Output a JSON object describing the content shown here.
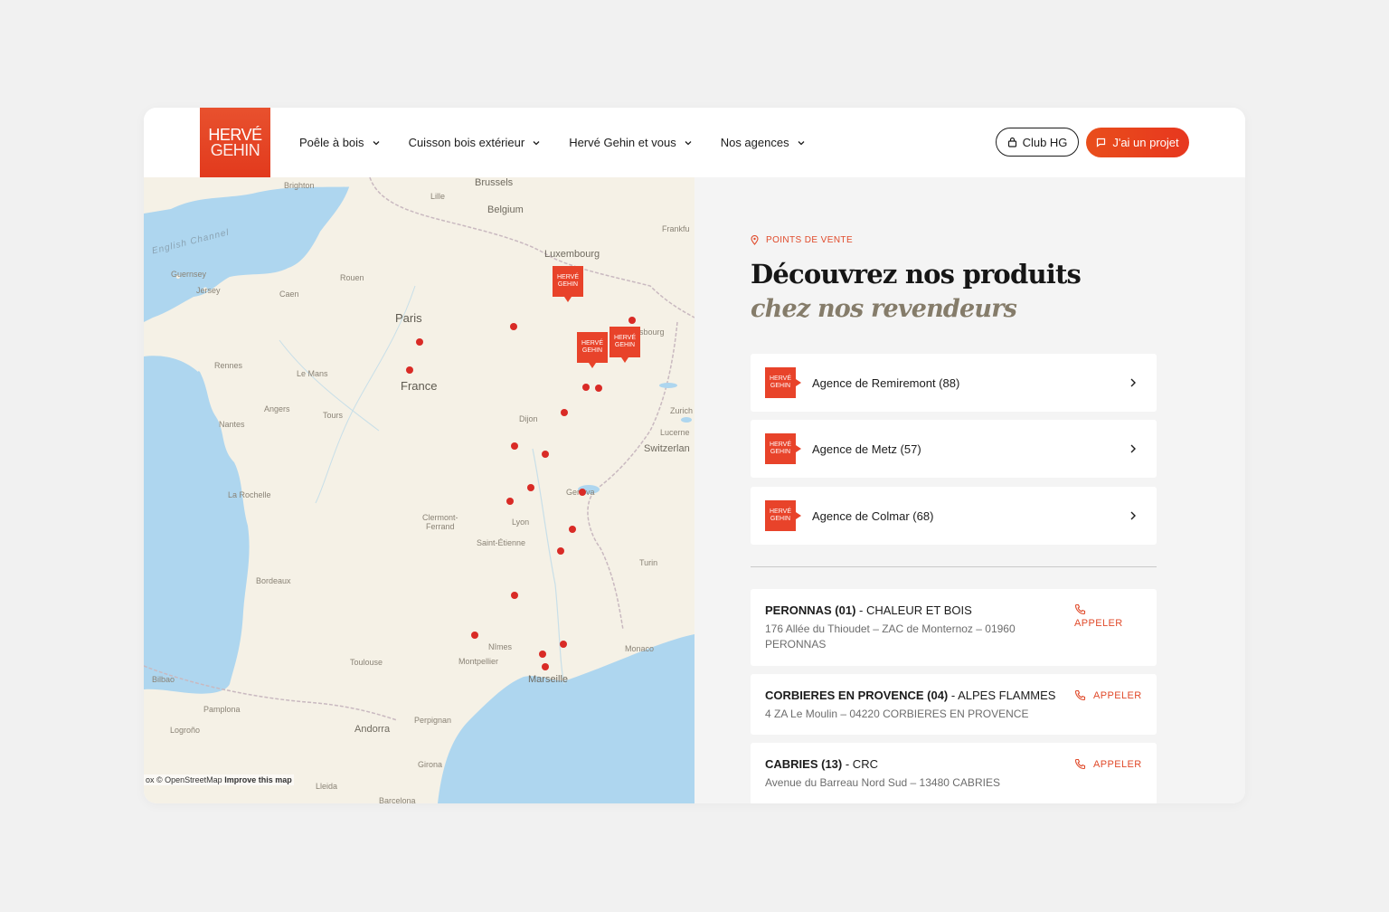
{
  "brand": {
    "line1": "HERVÉ",
    "line2": "GEHIN",
    "accent": "#e8432a"
  },
  "nav": [
    {
      "label": "Poêle à bois"
    },
    {
      "label": "Cuisson bois extérieur"
    },
    {
      "label": "Hervé Gehin et vous"
    },
    {
      "label": "Nos agences"
    }
  ],
  "header": {
    "club_label": "Club HG",
    "project_label": "J'ai un projet"
  },
  "map": {
    "labels": {
      "english_channel": "English Channel",
      "guernsey": "Guernsey",
      "jersey": "Jersey",
      "caen": "Caen",
      "rouen": "Rouen",
      "brighton": "Brighton",
      "lille": "Lille",
      "brussels": "Brussels",
      "belgium": "Belgium",
      "frankfurt": "Frankfu",
      "luxembourg": "Luxembourg",
      "paris": "Paris",
      "strasbourg": "sbourg",
      "rennes": "Rennes",
      "le_mans": "Le Mans",
      "france": "France",
      "angers": "Angers",
      "tours": "Tours",
      "nantes": "Nantes",
      "dijon": "Dijon",
      "zurich": "Zurich",
      "lucerne": "Lucerne",
      "switzerland": "Switzerlan",
      "la_rochelle": "La Rochelle",
      "geneva": "Geneva",
      "clermont": "Clermont-",
      "ferrand": "Ferrand",
      "lyon": "Lyon",
      "saint_etienne": "Saint-Étienne",
      "turin": "Turin",
      "bordeaux": "Bordeaux",
      "nimes": "Nîmes",
      "monaco": "Monaco",
      "toulouse": "Toulouse",
      "montpellier": "Montpellier",
      "marseille": "Marseille",
      "bilbao": "Bilbao",
      "pamplona": "Pamplona",
      "logrono": "Logroño",
      "andorra": "Andorra",
      "perpignan": "Perpignan",
      "girona": "Girona",
      "lleida": "Lleida",
      "barcelona": "Barcelona"
    },
    "attribution": "ox © OpenStreetMap",
    "improve": "Improve this map",
    "pin_line1": "HERVÉ",
    "pin_line2": "GEHIN",
    "dot_color": "#d92b26"
  },
  "panel": {
    "eyebrow": "POINTS DE VENTE",
    "title": "Découvrez nos produits",
    "subtitle": "chez nos revendeurs",
    "agencies": [
      {
        "name": "Agence de Remiremont (88)"
      },
      {
        "name": "Agence de Metz (57)"
      },
      {
        "name": "Agence de Colmar (68)"
      }
    ],
    "call_label": "APPELER",
    "dealers": [
      {
        "name": "PERONNAS (01)",
        "company": " - CHALEUR ET BOIS",
        "address": "176 Allée du Thioudet – ZAC de Monternoz – 01960 PERONNAS"
      },
      {
        "name": "CORBIERES EN PROVENCE (04)",
        "company": " - ALPES FLAMMES",
        "address": "4 ZA Le Moulin – 04220 CORBIERES EN PROVENCE"
      },
      {
        "name": "CABRIES (13)",
        "company": " - CRC",
        "address": "Avenue du Barreau Nord Sud – 13480 CABRIES"
      }
    ]
  }
}
